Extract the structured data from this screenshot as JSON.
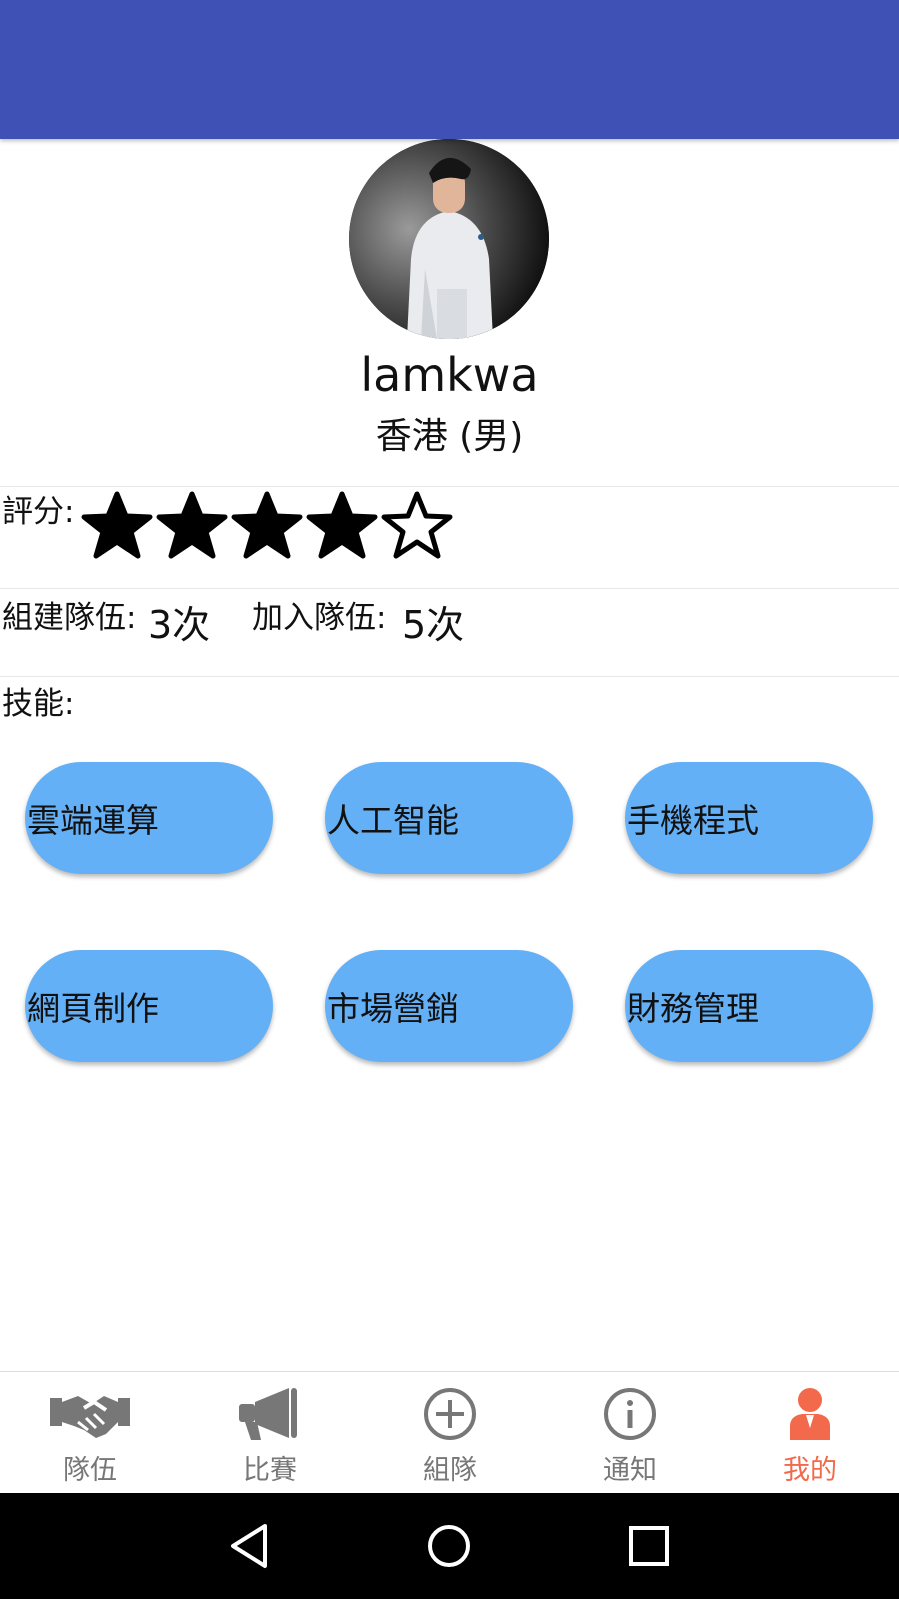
{
  "profile": {
    "username": "lamkwa",
    "location": "香港 (男)"
  },
  "rating": {
    "label": "評分:",
    "value": 4,
    "max": 5
  },
  "stats": {
    "created_label": "組建隊伍:",
    "created_value": "3次",
    "joined_label": "加入隊伍:",
    "joined_value": "5次"
  },
  "skills": {
    "label": "技能:",
    "items": [
      "雲端運算",
      "人工智能",
      "手機程式",
      "網頁制作",
      "市場營銷",
      "財務管理"
    ]
  },
  "bottom_nav": {
    "items": [
      {
        "label": "隊伍",
        "icon": "handshake-icon"
      },
      {
        "label": "比賽",
        "icon": "megaphone-icon"
      },
      {
        "label": "組隊",
        "icon": "add-circle-icon"
      },
      {
        "label": "通知",
        "icon": "info-circle-icon"
      },
      {
        "label": "我的",
        "icon": "person-icon"
      }
    ],
    "active_index": 4,
    "active_color": "#f26a4b",
    "inactive_color": "#777777"
  },
  "colors": {
    "app_bar": "#3f51b5",
    "chip": "#64b0f6"
  }
}
